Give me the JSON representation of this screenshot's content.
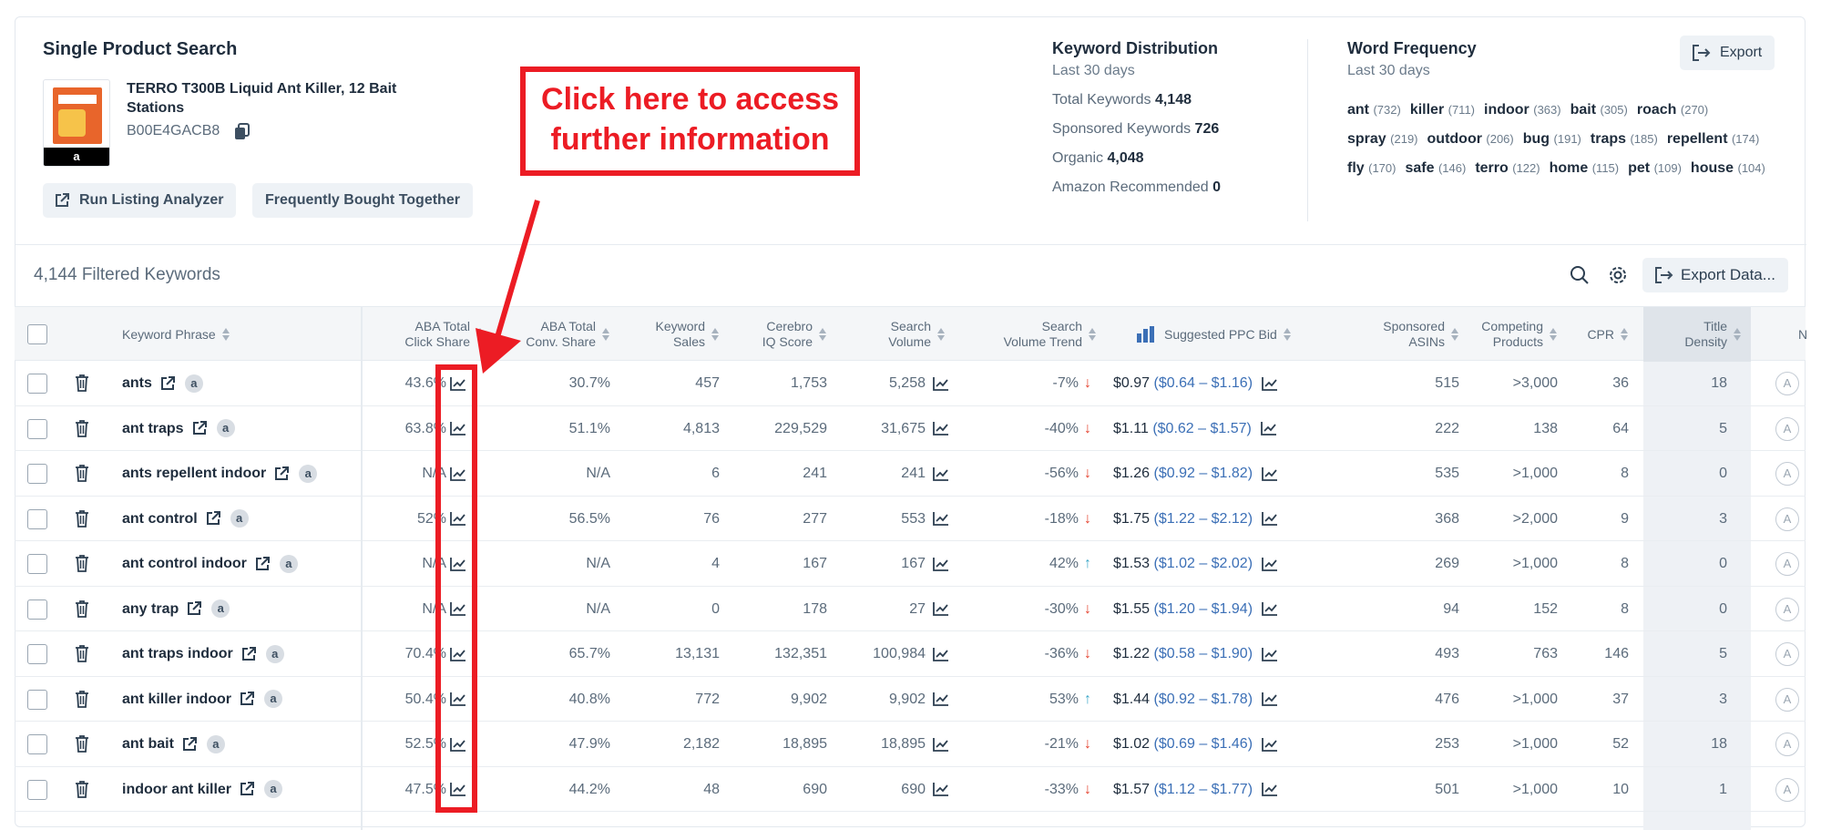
{
  "single_product": {
    "title": "Single Product Search",
    "product_name": "TERRO T300B Liquid Ant Killer, 12 Bait Stations",
    "asin": "B00E4GACB8",
    "thumb_brand": "a",
    "run_listing_analyzer": "Run Listing Analyzer",
    "frequently_bought_together": "Frequently Bought Together"
  },
  "keyword_distribution": {
    "title": "Keyword Distribution",
    "period": "Last 30 days",
    "total_label": "Total Keywords",
    "total": "4,148",
    "sponsored_label": "Sponsored Keywords",
    "sponsored": "726",
    "organic_label": "Organic",
    "organic": "4,048",
    "recommended_label": "Amazon Recommended",
    "recommended": "0"
  },
  "word_frequency": {
    "title": "Word Frequency",
    "period": "Last 30 days",
    "export_label": "Export",
    "words": [
      {
        "word": "ant",
        "count": "(732)"
      },
      {
        "word": "killer",
        "count": "(711)"
      },
      {
        "word": "indoor",
        "count": "(363)"
      },
      {
        "word": "bait",
        "count": "(305)"
      },
      {
        "word": "roach",
        "count": "(270)"
      },
      {
        "word": "spray",
        "count": "(219)"
      },
      {
        "word": "outdoor",
        "count": "(206)"
      },
      {
        "word": "bug",
        "count": "(191)"
      },
      {
        "word": "traps",
        "count": "(185)"
      },
      {
        "word": "repellent",
        "count": "(174)"
      },
      {
        "word": "fly",
        "count": "(170)"
      },
      {
        "word": "safe",
        "count": "(146)"
      },
      {
        "word": "terro",
        "count": "(122)"
      },
      {
        "word": "home",
        "count": "(115)"
      },
      {
        "word": "pet",
        "count": "(109)"
      },
      {
        "word": "house",
        "count": "(104)"
      }
    ]
  },
  "toolbar": {
    "filtered": "4,144 Filtered Keywords",
    "export_data": "Export Data..."
  },
  "columns": {
    "keyword": "Keyword Phrase",
    "aba_click_1": "ABA Total",
    "aba_click_2": "Click Share",
    "aba_conv_1": "ABA Total",
    "aba_conv_2": "Conv. Share",
    "kw_sales_1": "Keyword",
    "kw_sales_2": "Sales",
    "cerebro_1": "Cerebro",
    "cerebro_2": "IQ Score",
    "sv_1": "Search",
    "sv_2": "Volume",
    "svt_1": "Search",
    "svt_2": "Volume Trend",
    "ppc": "Suggested PPC Bid",
    "sa_1": "Sponsored",
    "sa_2": "ASINs",
    "cp_1": "Competing",
    "cp_2": "Products",
    "cpr": "CPR",
    "td_1": "Title",
    "td_2": "Density",
    "extra": "N"
  },
  "rows": [
    {
      "kw": "ants",
      "click": "43.6%",
      "conv": "30.7%",
      "sales": "457",
      "iq": "1,753",
      "sv": "5,258",
      "trend": "-7%",
      "dir": "down",
      "bid": "$0.97",
      "range": "($0.64 – $1.16)",
      "asins": "515",
      "comp": ">3,000",
      "cpr": "36",
      "td": "18",
      "a": "A"
    },
    {
      "kw": "ant traps",
      "click": "63.8%",
      "conv": "51.1%",
      "sales": "4,813",
      "iq": "229,529",
      "sv": "31,675",
      "trend": "-40%",
      "dir": "down",
      "bid": "$1.11",
      "range": "($0.62 – $1.57)",
      "asins": "222",
      "comp": "138",
      "cpr": "64",
      "td": "5",
      "a": "A"
    },
    {
      "kw": "ants repellent indoor",
      "click": "N/A",
      "conv": "N/A",
      "sales": "6",
      "iq": "241",
      "sv": "241",
      "trend": "-56%",
      "dir": "down",
      "bid": "$1.26",
      "range": "($0.92 – $1.82)",
      "asins": "535",
      "comp": ">1,000",
      "cpr": "8",
      "td": "0",
      "a": "A"
    },
    {
      "kw": "ant control",
      "click": "52%",
      "conv": "56.5%",
      "sales": "76",
      "iq": "277",
      "sv": "553",
      "trend": "-18%",
      "dir": "down",
      "bid": "$1.75",
      "range": "($1.22 – $2.12)",
      "asins": "368",
      "comp": ">2,000",
      "cpr": "9",
      "td": "3",
      "a": "A"
    },
    {
      "kw": "ant control indoor",
      "click": "N/A",
      "conv": "N/A",
      "sales": "4",
      "iq": "167",
      "sv": "167",
      "trend": "42%",
      "dir": "up",
      "bid": "$1.53",
      "range": "($1.02 – $2.02)",
      "asins": "269",
      "comp": ">1,000",
      "cpr": "8",
      "td": "0",
      "a": "A"
    },
    {
      "kw": "any trap",
      "click": "N/A",
      "conv": "N/A",
      "sales": "0",
      "iq": "178",
      "sv": "27",
      "trend": "-30%",
      "dir": "down",
      "bid": "$1.55",
      "range": "($1.20 – $1.94)",
      "asins": "94",
      "comp": "152",
      "cpr": "8",
      "td": "0",
      "a": "A"
    },
    {
      "kw": "ant traps indoor",
      "click": "70.4%",
      "conv": "65.7%",
      "sales": "13,131",
      "iq": "132,351",
      "sv": "100,984",
      "trend": "-36%",
      "dir": "down",
      "bid": "$1.22",
      "range": "($0.58 – $1.90)",
      "asins": "493",
      "comp": "763",
      "cpr": "146",
      "td": "5",
      "a": "A"
    },
    {
      "kw": "ant killer indoor",
      "click": "50.4%",
      "conv": "40.8%",
      "sales": "772",
      "iq": "9,902",
      "sv": "9,902",
      "trend": "53%",
      "dir": "up",
      "bid": "$1.44",
      "range": "($0.92 – $1.78)",
      "asins": "476",
      "comp": ">1,000",
      "cpr": "37",
      "td": "3",
      "a": "A"
    },
    {
      "kw": "ant bait",
      "click": "52.5%",
      "conv": "47.9%",
      "sales": "2,182",
      "iq": "18,895",
      "sv": "18,895",
      "trend": "-21%",
      "dir": "down",
      "bid": "$1.02",
      "range": "($0.69 – $1.46)",
      "asins": "253",
      "comp": ">1,000",
      "cpr": "52",
      "td": "18",
      "a": "A"
    },
    {
      "kw": "indoor ant killer",
      "click": "47.5%",
      "conv": "44.2%",
      "sales": "48",
      "iq": "690",
      "sv": "690",
      "trend": "-33%",
      "dir": "down",
      "bid": "$1.57",
      "range": "($1.12 – $1.77)",
      "asins": "501",
      "comp": ">1,000",
      "cpr": "10",
      "td": "1",
      "a": "A"
    }
  ],
  "annotation": {
    "line1": "Click here to access",
    "line2": "further information",
    "color": "#ec1c24"
  }
}
